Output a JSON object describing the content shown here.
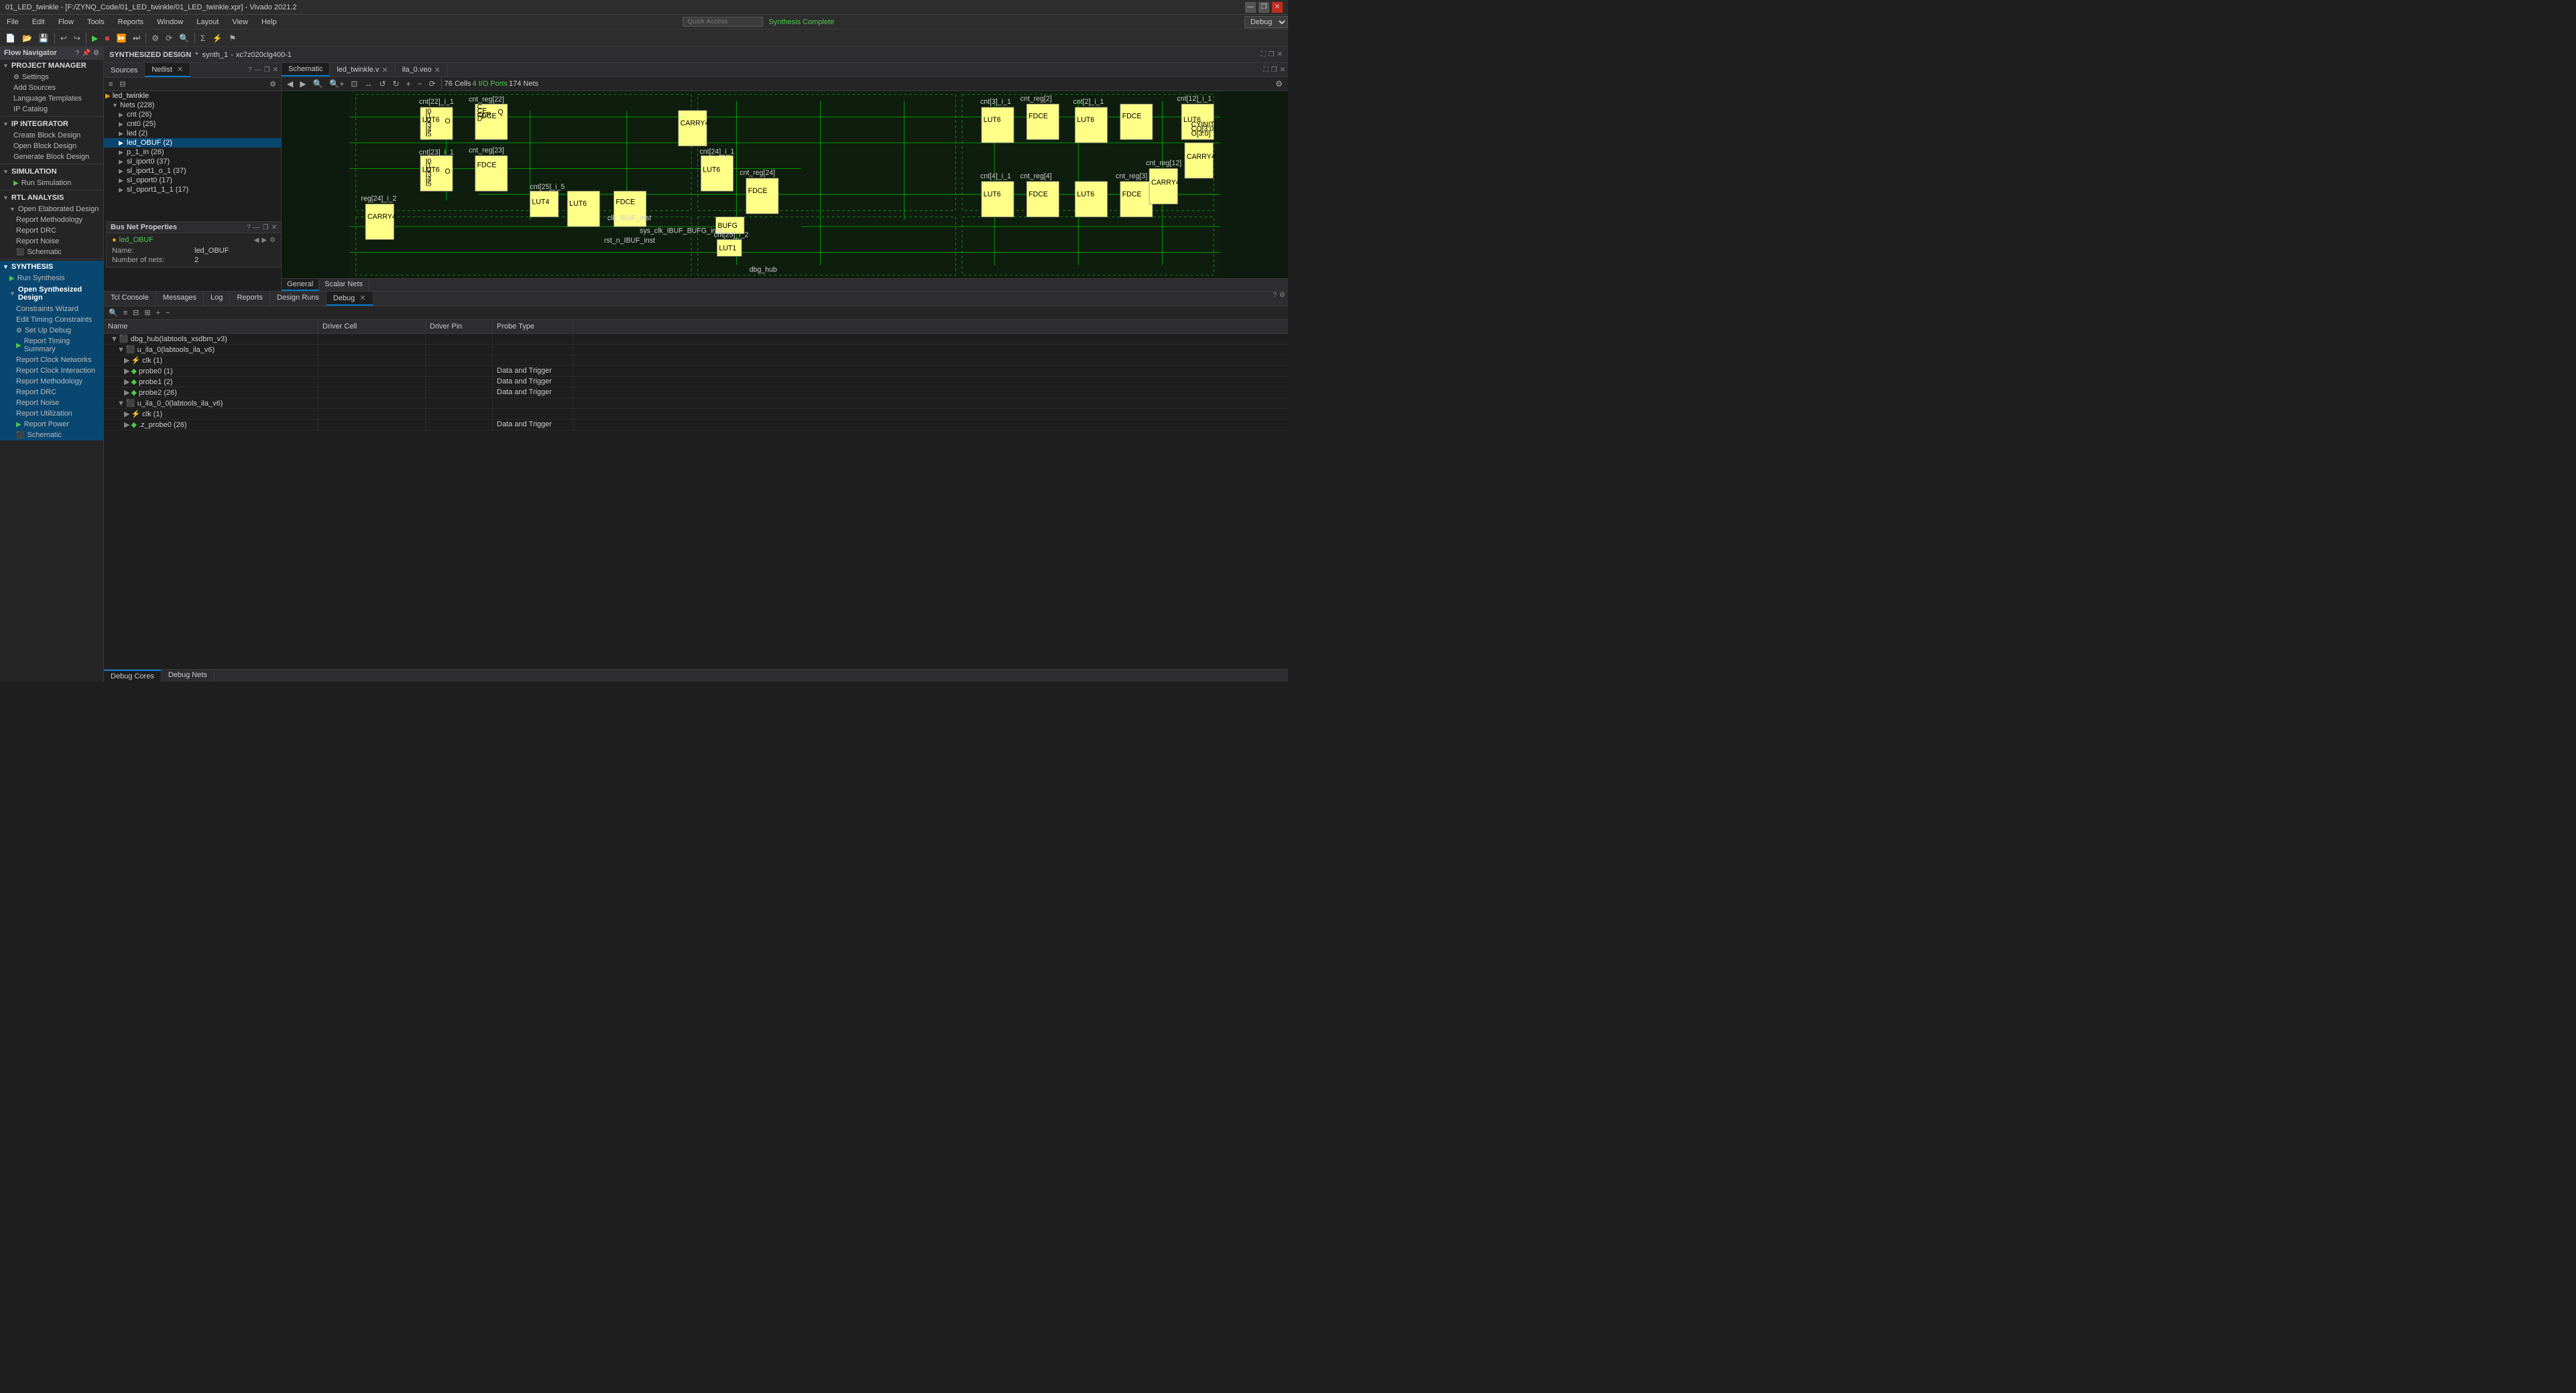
{
  "titlebar": {
    "title": "01_LED_twinkle - [F:/ZYNQ_Code/01_LED_twinkle/01_LED_twinkle.xpr] - Vivado 2021.2",
    "controls": [
      "minimize",
      "restore",
      "close"
    ]
  },
  "menubar": {
    "items": [
      "File",
      "Edit",
      "Flow",
      "Tools",
      "Reports",
      "Window",
      "Layout",
      "View",
      "Help"
    ],
    "search_placeholder": "Quick Access",
    "synthesis_status": "Synthesis Complete",
    "debug_label": "Debug"
  },
  "flow_navigator": {
    "header": "Flow Navigator",
    "sections": [
      {
        "name": "PROJECT MANAGER",
        "items": [
          {
            "label": "Settings",
            "icon": "⚙",
            "indent": 1
          },
          {
            "label": "Add Sources",
            "icon": "",
            "indent": 1
          },
          {
            "label": "Language Templates",
            "icon": "",
            "indent": 1
          },
          {
            "label": "IP Catalog",
            "icon": "",
            "indent": 1
          }
        ]
      },
      {
        "name": "IP INTEGRATOR",
        "items": [
          {
            "label": "Create Block Design",
            "indent": 1
          },
          {
            "label": "Open Block Design",
            "indent": 1
          },
          {
            "label": "Generate Block Design",
            "indent": 1
          }
        ]
      },
      {
        "name": "SIMULATION",
        "items": [
          {
            "label": "Run Simulation",
            "icon": "▶",
            "indent": 1
          }
        ]
      },
      {
        "name": "RTL ANALYSIS",
        "items": [
          {
            "label": "Open Elaborated Design",
            "indent": 1
          },
          {
            "label": "Report Methodology",
            "indent": 2
          },
          {
            "label": "Report DRC",
            "indent": 2
          },
          {
            "label": "Report Noise",
            "indent": 2
          },
          {
            "label": "Schematic",
            "icon": "⬛",
            "indent": 2
          }
        ]
      },
      {
        "name": "SYNTHESIS",
        "active": true,
        "items": [
          {
            "label": "Run Synthesis",
            "icon": "▶",
            "indent": 1
          },
          {
            "label": "Open Synthesized Design",
            "indent": 1,
            "bold": true
          },
          {
            "label": "Constraints Wizard",
            "indent": 2
          },
          {
            "label": "Edit Timing Constraints",
            "indent": 2
          },
          {
            "label": "Set Up Debug",
            "icon": "⚙",
            "indent": 2
          },
          {
            "label": "Report Timing Summary",
            "icon": "▶",
            "indent": 2
          },
          {
            "label": "Report Clock Networks",
            "indent": 2
          },
          {
            "label": "Report Clock Interaction",
            "indent": 2
          },
          {
            "label": "Report Methodology",
            "indent": 2
          },
          {
            "label": "Report DRC",
            "indent": 2
          },
          {
            "label": "Report Noise",
            "indent": 2
          },
          {
            "label": "Report Utilization",
            "indent": 2
          },
          {
            "label": "Report Power",
            "icon": "▶",
            "indent": 2
          },
          {
            "label": "Schematic",
            "icon": "⬛",
            "indent": 2
          }
        ]
      }
    ]
  },
  "design_header": {
    "title": "SYNTHESIZED DESIGN",
    "separator": "*",
    "synth": "synth_1",
    "part": "xc7z020clg400-1"
  },
  "sources_panel": {
    "tabs": [
      {
        "label": "Sources",
        "active": false
      },
      {
        "label": "Netlist",
        "active": true
      }
    ],
    "toolbar_icons": [
      "≡",
      "⊟"
    ],
    "tree": [
      {
        "label": "led_twinkle",
        "indent": 0,
        "expanded": true,
        "icon": "📁"
      },
      {
        "label": "Nets (228)",
        "indent": 1,
        "expanded": true
      },
      {
        "label": "cnt (26)",
        "indent": 2,
        "expanded": false
      },
      {
        "label": "cnt0 (25)",
        "indent": 2,
        "expanded": false
      },
      {
        "label": "led (2)",
        "indent": 2,
        "expanded": false
      },
      {
        "label": "led_OBUF (2)",
        "indent": 2,
        "expanded": false,
        "selected": true
      },
      {
        "label": "p_1_in (26)",
        "indent": 2,
        "expanded": false
      },
      {
        "label": "sl_iport0 (37)",
        "indent": 2,
        "expanded": false
      },
      {
        "label": "sl_iport1_o_1 (37)",
        "indent": 2,
        "expanded": false
      },
      {
        "label": "sl_oport0 (17)",
        "indent": 2,
        "expanded": false
      },
      {
        "label": "sl_oport1_1_1 (17)",
        "indent": 2,
        "expanded": false
      }
    ]
  },
  "bus_net_properties": {
    "header": "Bus Net Properties",
    "name_label": "Name:",
    "name_value": "led_OBUF",
    "nets_label": "Number of nets:",
    "nets_value": "2"
  },
  "schematic": {
    "tabs": [
      {
        "label": "Schematic",
        "active": true
      },
      {
        "label": "led_twinkle.v",
        "active": false
      },
      {
        "label": "ila_0.veo",
        "active": false
      }
    ],
    "toolbar": {
      "nav_icons": [
        "◀",
        "▶",
        "🔍-",
        "🔍+",
        "□",
        "↔",
        "↩",
        "↻",
        "+",
        "−",
        "⟳"
      ],
      "stats": {
        "cells_label": "76 Cells",
        "io_ports_label": "4 I/O Ports",
        "nets_label": "174 Nets"
      }
    }
  },
  "bottom_panel": {
    "tabs": [
      {
        "label": "Tcl Console"
      },
      {
        "label": "Messages"
      },
      {
        "label": "Log"
      },
      {
        "label": "Reports"
      },
      {
        "label": "Design Runs"
      },
      {
        "label": "Debug",
        "active": true
      }
    ],
    "debug": {
      "toolbar_icons": [
        "🔍",
        "≡",
        "⊟",
        "⊞",
        "+",
        "−"
      ],
      "columns": [
        "Name",
        "Driver Cell",
        "Driver Pin",
        "Probe Type"
      ],
      "rows": [
        {
          "name": "dbg_hub(labtools_xsdbm_v3)",
          "driver_cell": "",
          "driver_pin": "",
          "probe_type": "",
          "indent": 0,
          "expanded": true,
          "type": "hub"
        },
        {
          "name": "u_ila_0(labtools_ila_v6)",
          "driver_cell": "",
          "driver_pin": "",
          "probe_type": "",
          "indent": 1,
          "expanded": true,
          "type": "ila"
        },
        {
          "name": "clk (1)",
          "driver_cell": "",
          "driver_pin": "",
          "probe_type": "",
          "indent": 2,
          "expanded": false,
          "type": "port"
        },
        {
          "name": "probe0 (1)",
          "driver_cell": "",
          "driver_pin": "",
          "probe_type": "Data and Trigger",
          "indent": 2,
          "expanded": false,
          "type": "probe"
        },
        {
          "name": "probe1 (2)",
          "driver_cell": "",
          "driver_pin": "",
          "probe_type": "Data and Trigger",
          "indent": 2,
          "expanded": false,
          "type": "probe"
        },
        {
          "name": "probe2 (26)",
          "driver_cell": "",
          "driver_pin": "",
          "probe_type": "Data and Trigger",
          "indent": 2,
          "expanded": false,
          "type": "probe"
        },
        {
          "name": "u_ila_0_0(labtools_ila_v6)",
          "driver_cell": "",
          "driver_pin": "",
          "probe_type": "",
          "indent": 1,
          "expanded": true,
          "type": "ila"
        },
        {
          "name": "clk (1)",
          "driver_cell": "",
          "driver_pin": "",
          "probe_type": "",
          "indent": 2,
          "expanded": false,
          "type": "port"
        },
        {
          "name": ".z_probe0 (26)",
          "driver_cell": "",
          "driver_pin": "",
          "probe_type": "Data and Trigger",
          "indent": 2,
          "expanded": false,
          "type": "probe"
        }
      ],
      "bottom_tabs": [
        {
          "label": "Debug Cores",
          "active": true
        },
        {
          "label": "Debug Nets"
        }
      ]
    }
  },
  "icons": {
    "minimize": "—",
    "restore": "❐",
    "close": "✕",
    "arrow_right": "▶",
    "arrow_down": "▼",
    "settings": "⚙",
    "schematic": "⬛",
    "search": "🔍"
  }
}
